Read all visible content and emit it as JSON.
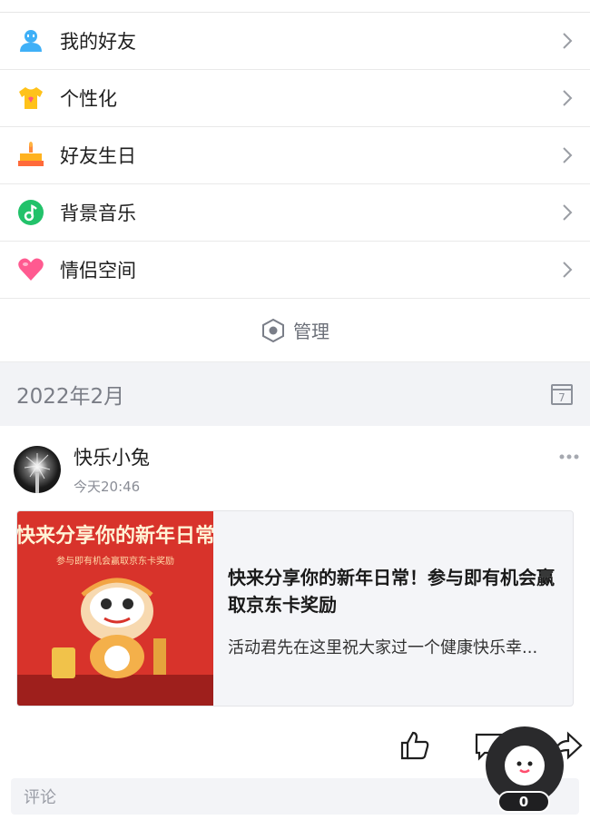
{
  "menu": {
    "items": [
      {
        "label": "我的好友",
        "icon": "friends-icon"
      },
      {
        "label": "个性化",
        "icon": "tshirt-icon"
      },
      {
        "label": "好友生日",
        "icon": "birthday-cake-icon"
      },
      {
        "label": "背景音乐",
        "icon": "music-note-icon"
      },
      {
        "label": "情侣空间",
        "icon": "heart-icon"
      }
    ]
  },
  "manage": {
    "label": "管理",
    "icon": "hexagon-icon"
  },
  "feed": {
    "month": "2022年2月",
    "calendar_day": "7",
    "post": {
      "username": "快乐小兔",
      "time": "今天20:46",
      "card": {
        "thumb_headline": "快来分享你的新年日常",
        "thumb_sub": "参与即有机会赢取京东卡奖励",
        "title": "快来分享你的新年日常！参与即有机会赢取京东卡奖励",
        "description": "活动君先在这里祝大家过一个健康快乐幸..."
      },
      "comment_placeholder": "评论"
    }
  },
  "floating": {
    "count": "0"
  },
  "colors": {
    "accent_blue": "#39a7f5",
    "card_red": "#d8332b",
    "music_green": "#22c26a",
    "heart_pink": "#ff4f86"
  }
}
